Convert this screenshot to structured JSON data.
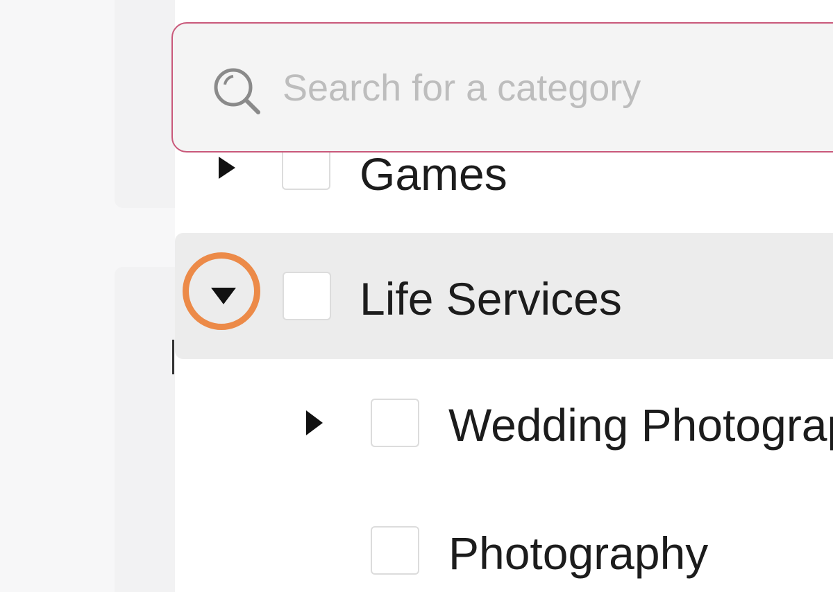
{
  "search": {
    "placeholder": "Search for a category",
    "value": ""
  },
  "categories": [
    {
      "label": "Games",
      "expanded": false,
      "checked": false,
      "level": 0
    },
    {
      "label": "Life Services",
      "expanded": true,
      "checked": false,
      "level": 0,
      "highlighted": true
    },
    {
      "label": "Wedding Photography",
      "expanded": false,
      "checked": false,
      "level": 1
    },
    {
      "label": "Photography",
      "expanded": false,
      "checked": false,
      "level": 1
    }
  ],
  "colors": {
    "search_border": "#c9587a",
    "highlight_ring": "#ec8a48",
    "active_row": "#ececec"
  }
}
